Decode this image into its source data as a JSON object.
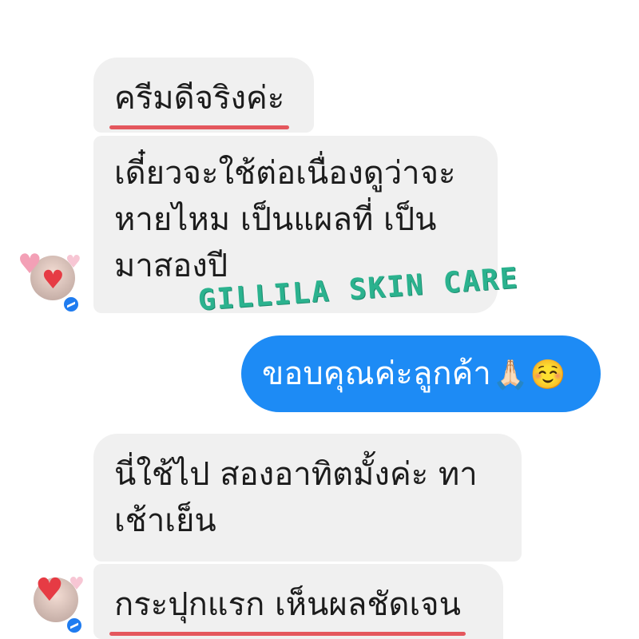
{
  "conversation": {
    "messages": [
      {
        "text": "ครีมดีจริงค่ะ"
      },
      {
        "lines": [
          "เดี๋ยวจะใช้ต่อเนื่องดูว่าจะ",
          "หายไหม เป็นแผลที่ เป็น",
          "มาสองปี"
        ]
      },
      {
        "text": "ขอบคุณค่ะลูกค้า",
        "emojis": [
          "🙏🏻",
          "☺️"
        ]
      },
      {
        "lines": [
          "นี่ใช้ไป สองอาทิตมั้งค่ะ ทา",
          "เช้าเย็น"
        ]
      },
      {
        "text": "กระปุกแรก เห็นผลชัดเจน"
      }
    ]
  },
  "watermark": {
    "text": "GILLILA SKIN CARE"
  },
  "colors": {
    "incoming_bubble": "#f0f0f0",
    "outgoing_bubble": "#1d8bf5",
    "underline": "#e4575d",
    "watermark": "#2bb28e"
  },
  "icons": {
    "avatar_badge": "messenger-icon",
    "avatar_decoration": "heart-icon"
  }
}
